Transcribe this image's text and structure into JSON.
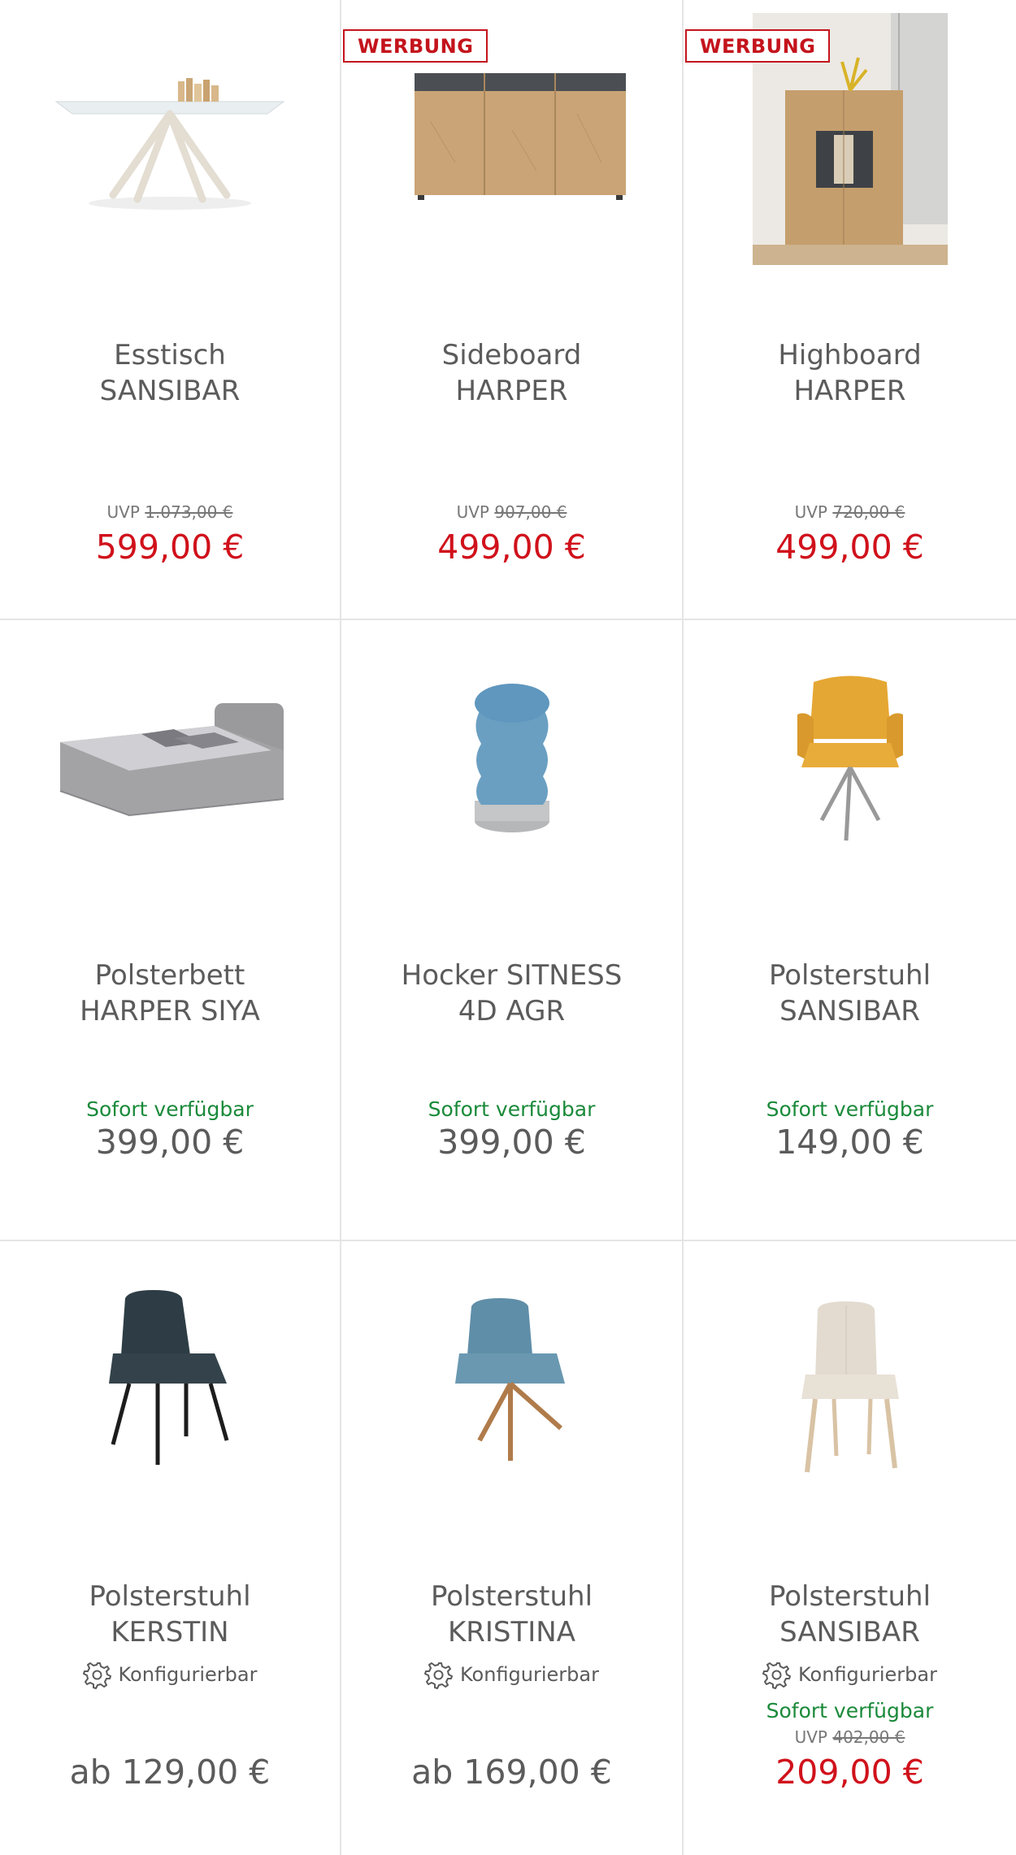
{
  "products": [
    {
      "name_line1": "Esstisch",
      "name_line2": "SANSIBAR",
      "uvp_label": "UVP",
      "uvp_price": "1.073,00 €",
      "price": "599,00 €",
      "image_icon": "dining-table-image"
    },
    {
      "badge": "WERBUNG",
      "name_line1": "Sideboard",
      "name_line2": "HARPER",
      "uvp_label": "UVP",
      "uvp_price": "907,00 €",
      "price": "499,00 €",
      "image_icon": "sideboard-image"
    },
    {
      "badge": "WERBUNG",
      "name_line1": "Highboard",
      "name_line2": "HARPER",
      "uvp_label": "UVP",
      "uvp_price": "720,00 €",
      "price": "499,00 €",
      "image_icon": "highboard-image"
    },
    {
      "name_line1": "Polsterbett",
      "name_line2": "HARPER SIYA",
      "availability": "Sofort verfügbar",
      "price": "399,00 €",
      "image_icon": "bed-image"
    },
    {
      "name_line1": "Hocker SITNESS",
      "name_line2": "4D AGR",
      "availability": "Sofort verfügbar",
      "price": "399,00 €",
      "image_icon": "stool-image"
    },
    {
      "name_line1": "Polsterstuhl",
      "name_line2": "SANSIBAR",
      "availability": "Sofort verfügbar",
      "price": "149,00 €",
      "image_icon": "armchair-yellow-image"
    },
    {
      "name_line1": "Polsterstuhl",
      "name_line2": "KERSTIN",
      "config_label": "Konfigurierbar",
      "price": "ab 129,00 €",
      "image_icon": "chair-dark-image"
    },
    {
      "name_line1": "Polsterstuhl",
      "name_line2": "KRISTINA",
      "config_label": "Konfigurierbar",
      "price": "ab 169,00 €",
      "image_icon": "chair-blue-image"
    },
    {
      "name_line1": "Polsterstuhl",
      "name_line2": "SANSIBAR",
      "config_label": "Konfigurierbar",
      "availability": "Sofort verfügbar",
      "uvp_label": "UVP",
      "uvp_price": "402,00 €",
      "price": "209,00 €",
      "image_icon": "chair-beige-image"
    }
  ],
  "colors": {
    "sale": "#d0111b",
    "available": "#1a8a3a",
    "badge": "#c4141c",
    "text": "#5b5b5b",
    "divider": "#e5e5e5"
  }
}
